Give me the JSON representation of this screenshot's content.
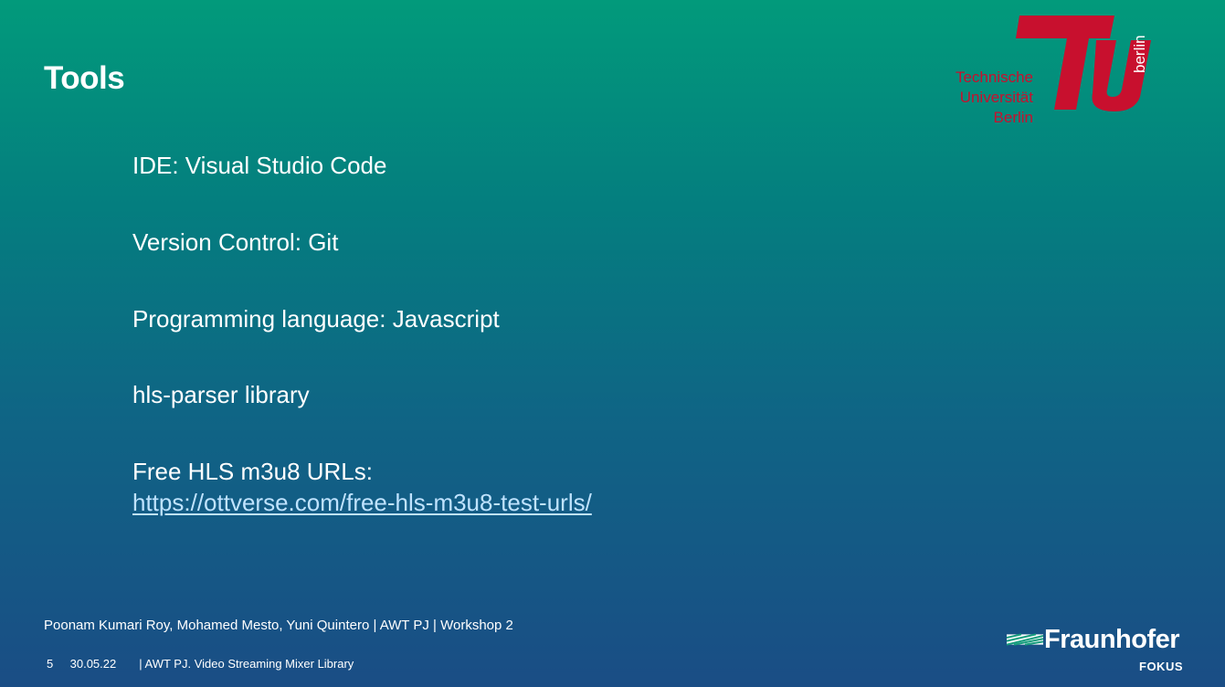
{
  "slide": {
    "title": "Tools",
    "items": [
      "IDE: Visual Studio Code",
      "Version Control: Git",
      "Programming language: Javascript",
      "hls-parser library",
      "Free HLS m3u8 URLs:"
    ],
    "link": "https://ottverse.com/free-hls-m3u8-test-urls/"
  },
  "footer": {
    "authors": "Poonam Kumari Roy, Mohamed Mesto, Yuni Quintero | AWT PJ | Workshop 2",
    "page_number": "5",
    "date": "30.05.22",
    "course": "| AWT PJ. Video Streaming Mixer Library"
  },
  "logos": {
    "tu": {
      "line1": "Technische",
      "line2": "Universität",
      "line3": "Berlin",
      "badge": "berlin",
      "color": "#c8102e"
    },
    "fraunhofer": {
      "name": "Fraunhofer",
      "sub": "FOKUS"
    }
  }
}
